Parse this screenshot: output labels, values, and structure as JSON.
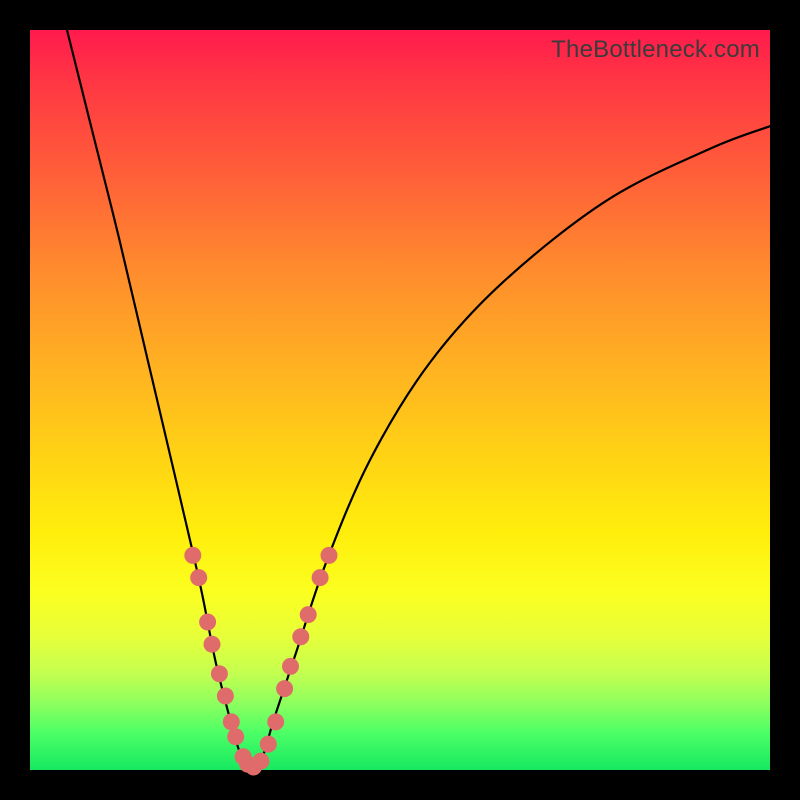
{
  "watermark": "TheBottleneck.com",
  "chart_data": {
    "type": "line",
    "title": "",
    "xlabel": "",
    "ylabel": "",
    "xlim": [
      0,
      100
    ],
    "ylim": [
      0,
      100
    ],
    "grid": false,
    "legend": false,
    "series": [
      {
        "name": "bottleneck-curve",
        "x": [
          5,
          8,
          12,
          16,
          20,
          23,
          25,
          27,
          28.5,
          30,
          31.5,
          33,
          36,
          40,
          46,
          54,
          64,
          78,
          92,
          100
        ],
        "y": [
          100,
          88,
          72,
          55,
          38,
          25,
          15,
          7,
          2,
          0,
          2,
          7,
          16,
          28,
          42,
          55,
          66,
          77,
          84,
          87
        ]
      }
    ],
    "markers": {
      "name": "highlight-points",
      "points": [
        {
          "x": 22.0,
          "y": 29
        },
        {
          "x": 22.8,
          "y": 26
        },
        {
          "x": 24.0,
          "y": 20
        },
        {
          "x": 24.6,
          "y": 17
        },
        {
          "x": 25.6,
          "y": 13
        },
        {
          "x": 26.4,
          "y": 10
        },
        {
          "x": 27.2,
          "y": 6.5
        },
        {
          "x": 27.8,
          "y": 4.5
        },
        {
          "x": 28.8,
          "y": 1.8
        },
        {
          "x": 29.4,
          "y": 0.8
        },
        {
          "x": 30.2,
          "y": 0.4
        },
        {
          "x": 31.2,
          "y": 1.2
        },
        {
          "x": 32.2,
          "y": 3.5
        },
        {
          "x": 33.2,
          "y": 6.5
        },
        {
          "x": 34.4,
          "y": 11
        },
        {
          "x": 35.2,
          "y": 14
        },
        {
          "x": 36.6,
          "y": 18
        },
        {
          "x": 37.6,
          "y": 21
        },
        {
          "x": 39.2,
          "y": 26
        },
        {
          "x": 40.4,
          "y": 29
        }
      ]
    },
    "gradient_stops": [
      {
        "pos": 0,
        "color": "#ff1a4d"
      },
      {
        "pos": 18,
        "color": "#ff5a3a"
      },
      {
        "pos": 46,
        "color": "#ffb321"
      },
      {
        "pos": 68,
        "color": "#ffee0c"
      },
      {
        "pos": 95,
        "color": "#4cff66"
      },
      {
        "pos": 100,
        "color": "#17e860"
      }
    ]
  }
}
